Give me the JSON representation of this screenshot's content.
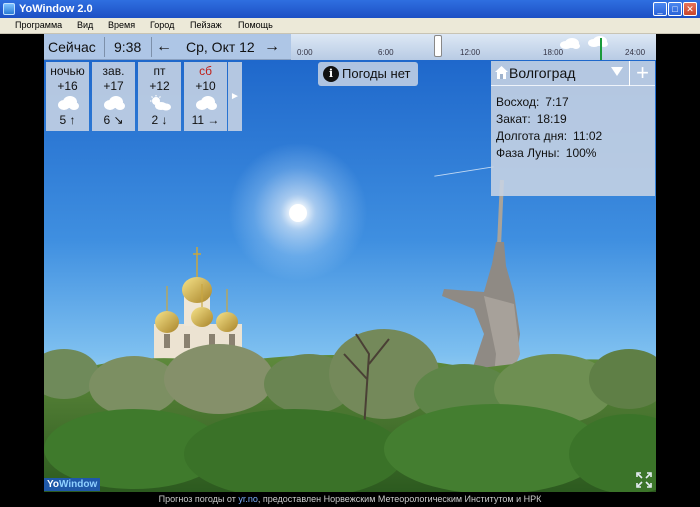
{
  "window": {
    "title": "YoWindow 2.0",
    "controls": {
      "minimize": "_",
      "maximize": "□",
      "close": "✕"
    }
  },
  "menu": {
    "items": [
      {
        "label": "Программа"
      },
      {
        "label": "Вид"
      },
      {
        "label": "Время"
      },
      {
        "label": "Город"
      },
      {
        "label": "Пейзаж"
      },
      {
        "label": "Помощь"
      }
    ]
  },
  "timeline": {
    "now_label": "Сейчас",
    "time": "9:38",
    "prev_icon": "←",
    "date": "Ср, Окт 12",
    "next_icon": "→",
    "hours": [
      "0:00",
      "6:00",
      "12:00",
      "18:00",
      "24:00"
    ]
  },
  "forecast": {
    "days": [
      {
        "name": "ночью",
        "temp": "+16",
        "icon": "cloud-icon",
        "wind": "5 ↑"
      },
      {
        "name": "зав.",
        "temp": "+17",
        "icon": "cloud-icon",
        "wind": "6 ↘"
      },
      {
        "name": "пт",
        "temp": "+12",
        "icon": "sun-cloud-icon",
        "wind": "2 ↓"
      },
      {
        "name": "сб",
        "temp": "+10",
        "icon": "cloud-icon",
        "wind": "11 →"
      }
    ],
    "more_icon": "►"
  },
  "weather_notice": {
    "icon": "i",
    "label": "Погоды нет"
  },
  "city": {
    "name": "Волгоград",
    "add_icon": "+",
    "rows": [
      {
        "label": "Восход:",
        "value": "7:17"
      },
      {
        "label": "Закат:",
        "value": "18:19"
      },
      {
        "label": "Долгота дня:",
        "value": "11:02"
      },
      {
        "label": "Фаза Луны:",
        "value": "100%"
      }
    ]
  },
  "logo": {
    "yo": "Yo",
    "window": "Window"
  },
  "footer": {
    "prefix": "Прогноз погоды от",
    "link": "yr.no",
    "suffix": ", предоставлен Норвежским Метеорологическим Институтом и НРК"
  },
  "colors": {
    "titlebar": "#1c4fc4",
    "sky_top": "#1a62c8",
    "panel": "#c8d4e4",
    "saturday": "#c0201a"
  }
}
